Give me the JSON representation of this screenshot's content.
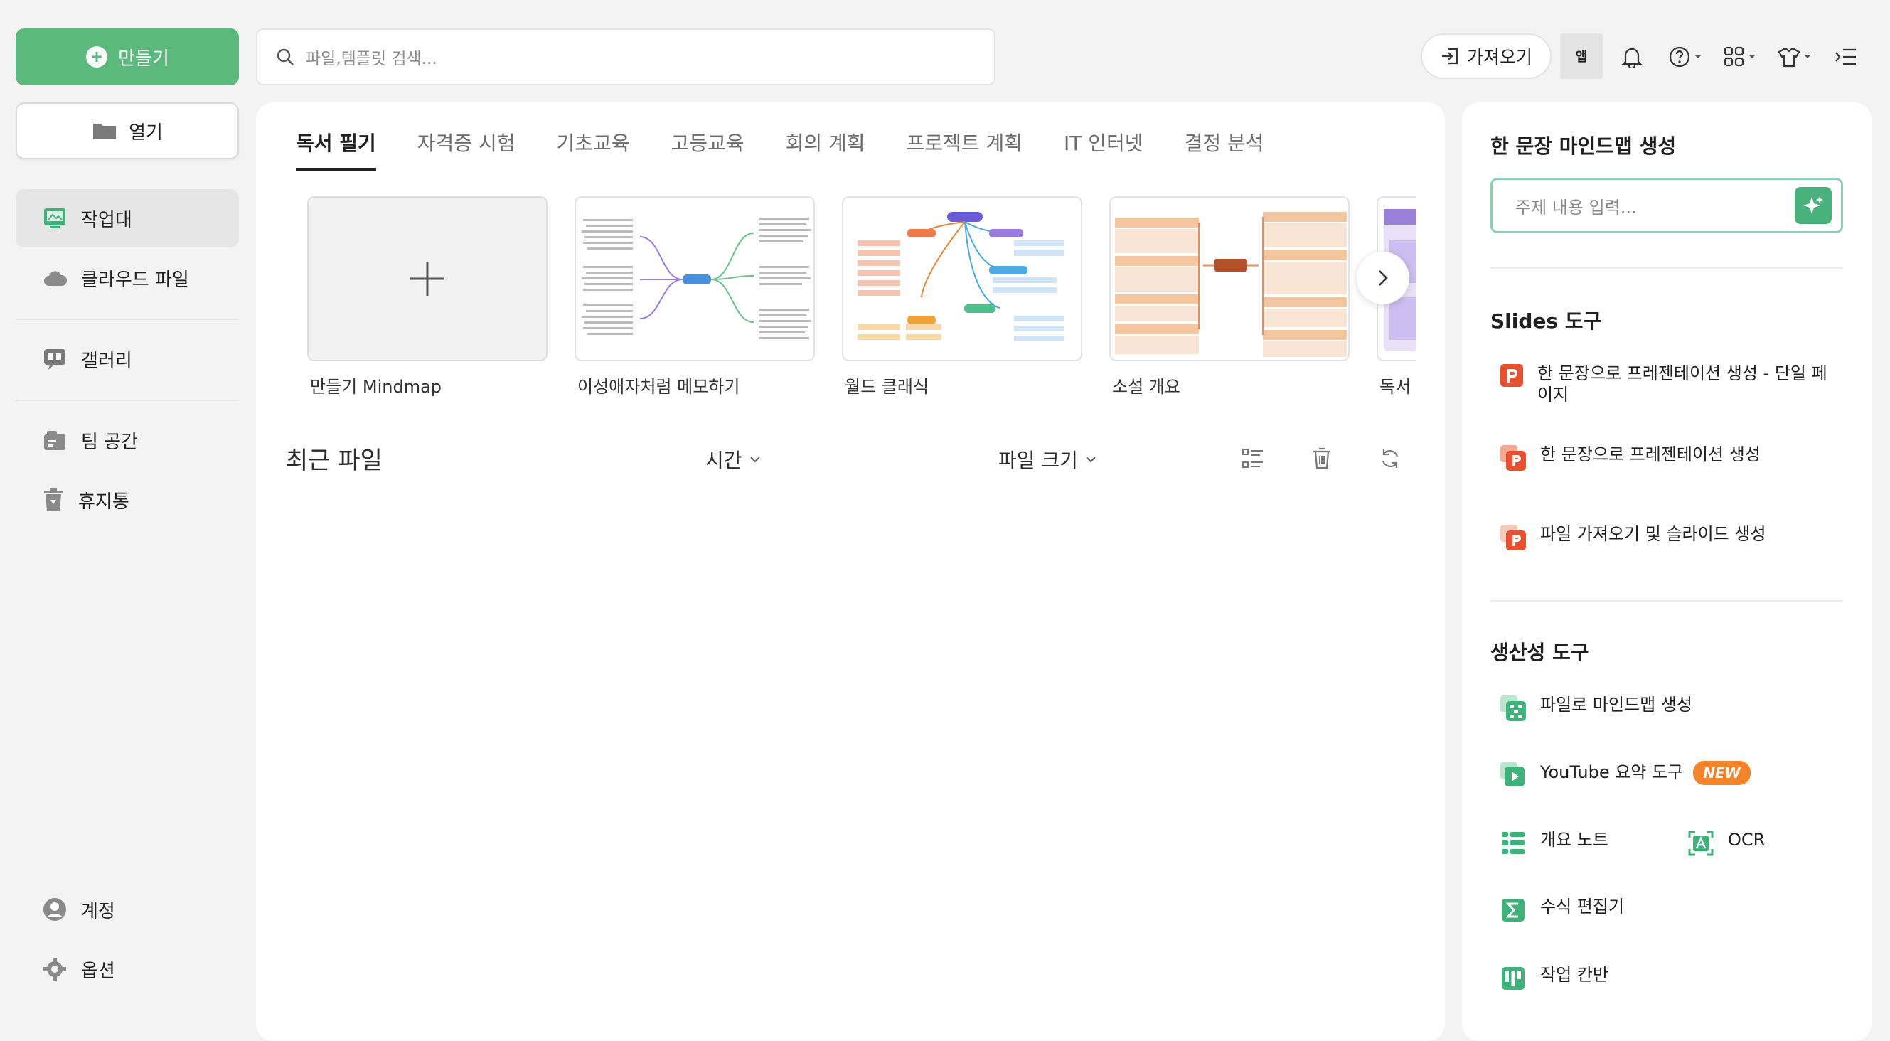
{
  "sidebar": {
    "create_label": "만들기",
    "open_label": "열기",
    "items": [
      {
        "label": "작업대"
      },
      {
        "label": "클라우드 파일"
      },
      {
        "label": "갤러리"
      },
      {
        "label": "팀 공간"
      },
      {
        "label": "휴지통"
      }
    ],
    "bottom": [
      {
        "label": "계정"
      },
      {
        "label": "옵션"
      }
    ]
  },
  "search": {
    "placeholder": "파일,템플릿 검색..."
  },
  "toolbar": {
    "import_label": "가져오기",
    "app_label": "앱"
  },
  "tabs": [
    "독서 필기",
    "자격증 시험",
    "기초교육",
    "고등교육",
    "회의 계획",
    "프로젝트 계획",
    "IT 인터넷",
    "결정 분석"
  ],
  "templates": [
    {
      "label": "만들기 Mindmap"
    },
    {
      "label": "이성애자처럼 메모하기"
    },
    {
      "label": "월드 클래식"
    },
    {
      "label": "소설 개요"
    },
    {
      "label": "독서"
    }
  ],
  "recent": {
    "title": "최근 파일",
    "sort_time": "시간",
    "sort_size": "파일 크기"
  },
  "right_panel": {
    "one_sentence_title": "한 문장 마인드맵 생성",
    "topic_placeholder": "주제 내용 입력...",
    "slides_title": "Slides 도구",
    "slides_items": [
      {
        "label": "한 문장으로 프레젠테이션 생성 - 단일 페이지"
      },
      {
        "label": "한 문장으로 프레젠테이션 생성"
      },
      {
        "label": "파일 가져오기 및 슬라이드 생성"
      }
    ],
    "productivity_title": "생산성 도구",
    "productivity_items": [
      {
        "label": "파일로 마인드맵 생성"
      },
      {
        "label": "YouTube 요약 도구",
        "badge": "NEW"
      },
      {
        "label": "개요 노트"
      },
      {
        "label": "OCR"
      },
      {
        "label": "수식 편집기"
      },
      {
        "label": "작업 칸반"
      }
    ]
  },
  "colors": {
    "accent": "#5ab97b",
    "badge": "#f5832a",
    "slides_icon": "#e8512f"
  }
}
